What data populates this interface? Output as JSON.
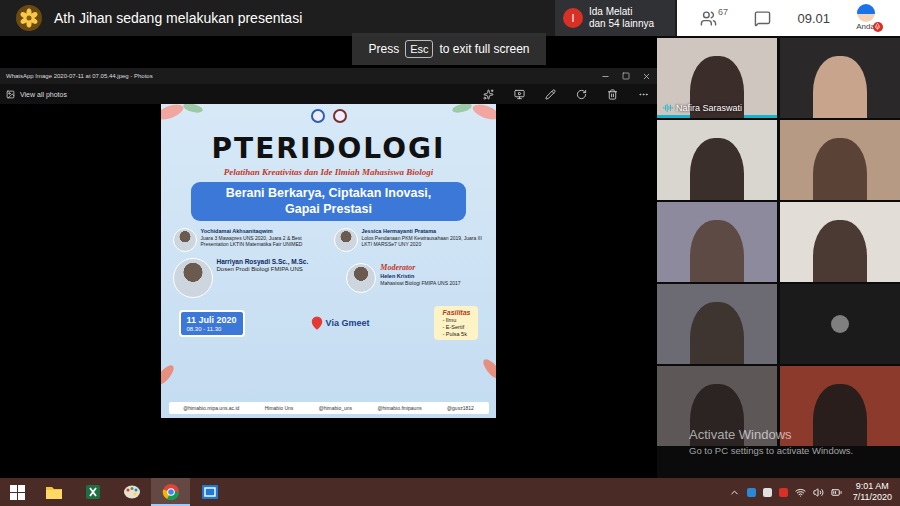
{
  "meet": {
    "title": "Ath Jihan sedang melakukan presentasi",
    "fullscreen_hint": {
      "before": "Press",
      "key": "Esc",
      "after": "to exit full screen"
    },
    "notification": {
      "initial": "I",
      "lines": [
        "Ida Melati",
        "dan 54 lainnya"
      ]
    },
    "participants_count": "67",
    "time": "09.01",
    "self_label": "Anda"
  },
  "photos_window": {
    "title": "WhatsApp Image 2020-07-11 at 07.05.44.jpeg - Photos",
    "view_all": "View all photos"
  },
  "poster": {
    "title": "PTERIDOLOGI",
    "subtitle": "Pelatihan Kreativitas dan Ide Ilmiah Mahasiswa Biologi",
    "tagline": "Berani Berkarya, Ciptakan Inovasi, Gapai Prestasi",
    "speakers": [
      {
        "name": "Yochidamai Akhsanitaqwim",
        "info": "Juara 3 Mawapres UNS 2020, Juara 2 & Best Presentation LKTIN Matematika Fair UNIMED"
      },
      {
        "name": "Jessica Hermayanti Pratama",
        "info": "Lolos Pendanaan PKM Kewirausahaan 2019, Juara III LKTI MARSSe7 UNY 2020"
      }
    ],
    "lecturer": {
      "name": "Harriyan Rosyadi S.Sc., M.Sc.",
      "info": "Dosen Prodi Biologi FMIPA UNS"
    },
    "moderator": {
      "label": "Moderator",
      "name": "Helen Kristin",
      "info": "Mahasiswi Biologi FMIPA UNS 2017"
    },
    "date": "11 Juli 2020",
    "hours": "08.30 - 11.30",
    "venue": "Via Gmeet",
    "facilities": {
      "title": "Fasilitas",
      "items": [
        "- Ilmu",
        "- E-Sertif",
        "- Pulsa 5k"
      ]
    },
    "socials": [
      "@himabio.mipa.uns.ac.id",
      "Himabio Uns",
      "@himabio_uns",
      "@himabio.fmipauns",
      "@gusz1812"
    ]
  },
  "participants": [
    {
      "name": "Nafira Saraswati",
      "speaking": true
    },
    {
      "speaking": false
    },
    {
      "speaking": false
    },
    {
      "speaking": false
    },
    {
      "speaking": false
    },
    {
      "speaking": false
    },
    {
      "speaking": false
    },
    {
      "speaking": false
    },
    {
      "speaking": false
    },
    {
      "speaking": false
    }
  ],
  "watermark": {
    "title": "Activate Windows",
    "subtitle": "Go to PC settings to activate Windows."
  },
  "taskbar": {
    "apps": [
      {
        "kind": "explorer",
        "selected": false
      },
      {
        "kind": "excel",
        "selected": false
      },
      {
        "kind": "paint",
        "selected": false
      },
      {
        "kind": "chrome",
        "selected": true
      },
      {
        "kind": "photos",
        "selected": false
      }
    ],
    "time": "9:01 AM",
    "date": "7/11/2020"
  }
}
